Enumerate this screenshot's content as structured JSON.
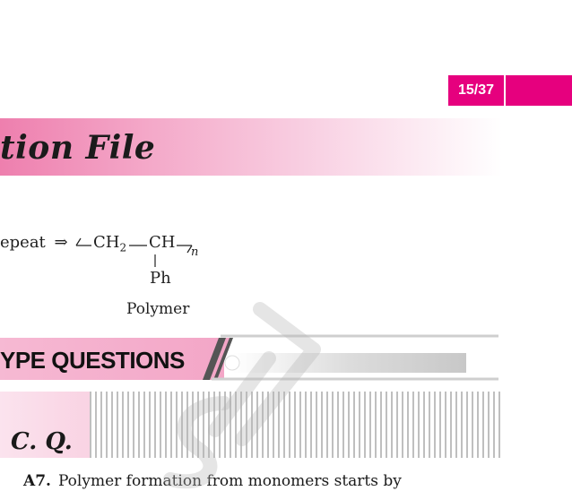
{
  "page": {
    "counter": "15/37"
  },
  "header": {
    "title": "tion File"
  },
  "chem": {
    "prefix": "epeat",
    "arrow": "⇒",
    "open_bracket": "⟵",
    "ch2": "CH",
    "ch2_sub": "2",
    "dash": "—",
    "ch": "CH",
    "close_bracket": "⟶",
    "n": "n",
    "ph": "Ph",
    "caption": "Polymer"
  },
  "section": {
    "title": "YPE QUESTIONS"
  },
  "subsection": {
    "label": "C. Q."
  },
  "answer": {
    "number": "A7.",
    "text": "Polymer formation from monomers starts by"
  }
}
